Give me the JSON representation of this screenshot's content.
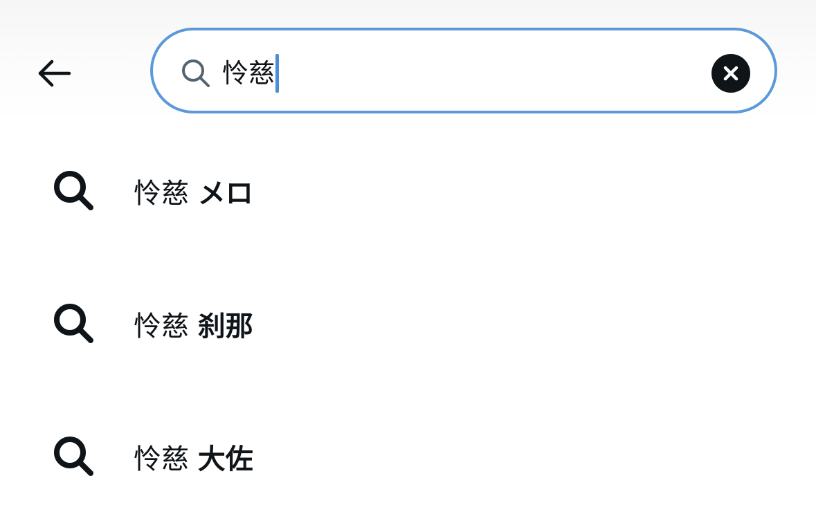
{
  "search": {
    "query": "怜慈",
    "clear_icon": "x-icon",
    "search_icon": "search-icon"
  },
  "nav": {
    "back_icon": "arrow-left-icon"
  },
  "colors": {
    "focus_border": "#5a9ad8",
    "caret": "#4a8fd6",
    "text": "#0f1419",
    "clear_button_bg": "#0f1419"
  },
  "suggestions": [
    {
      "prefix": "怜慈",
      "completion": "メロ"
    },
    {
      "prefix": "怜慈",
      "completion": "刹那"
    },
    {
      "prefix": "怜慈",
      "completion": "大佐"
    }
  ]
}
